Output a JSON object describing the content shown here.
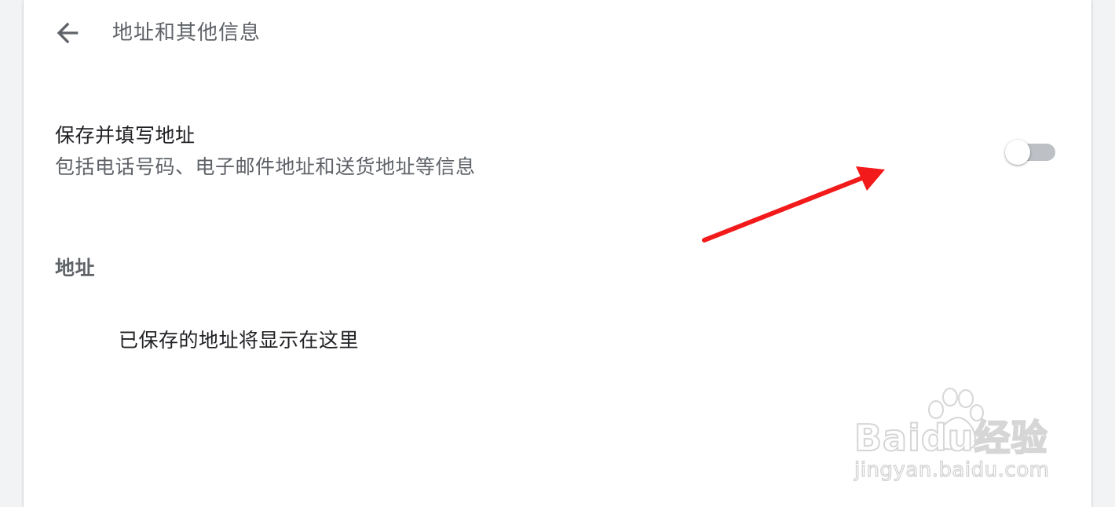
{
  "header": {
    "back_icon": "arrow-back-icon",
    "title": "地址和其他信息"
  },
  "autofill_setting": {
    "title": "保存并填写地址",
    "description": "包括电话号码、电子邮件地址和送货地址等信息",
    "toggle_state": "off"
  },
  "addresses_section": {
    "heading": "地址",
    "empty_message": "已保存的地址将显示在这里"
  },
  "annotation": {
    "icon": "red-arrow-icon",
    "color": "#f21a1a"
  },
  "watermark": {
    "logo_text": "Baidu经验",
    "url": "jingyan.baidu.com"
  },
  "colors": {
    "page_bg": "#f1f3f4",
    "card_bg": "#ffffff",
    "primary_text": "#202124",
    "secondary_text": "#5f6368",
    "toggle_track_off": "#bdc1c6"
  }
}
